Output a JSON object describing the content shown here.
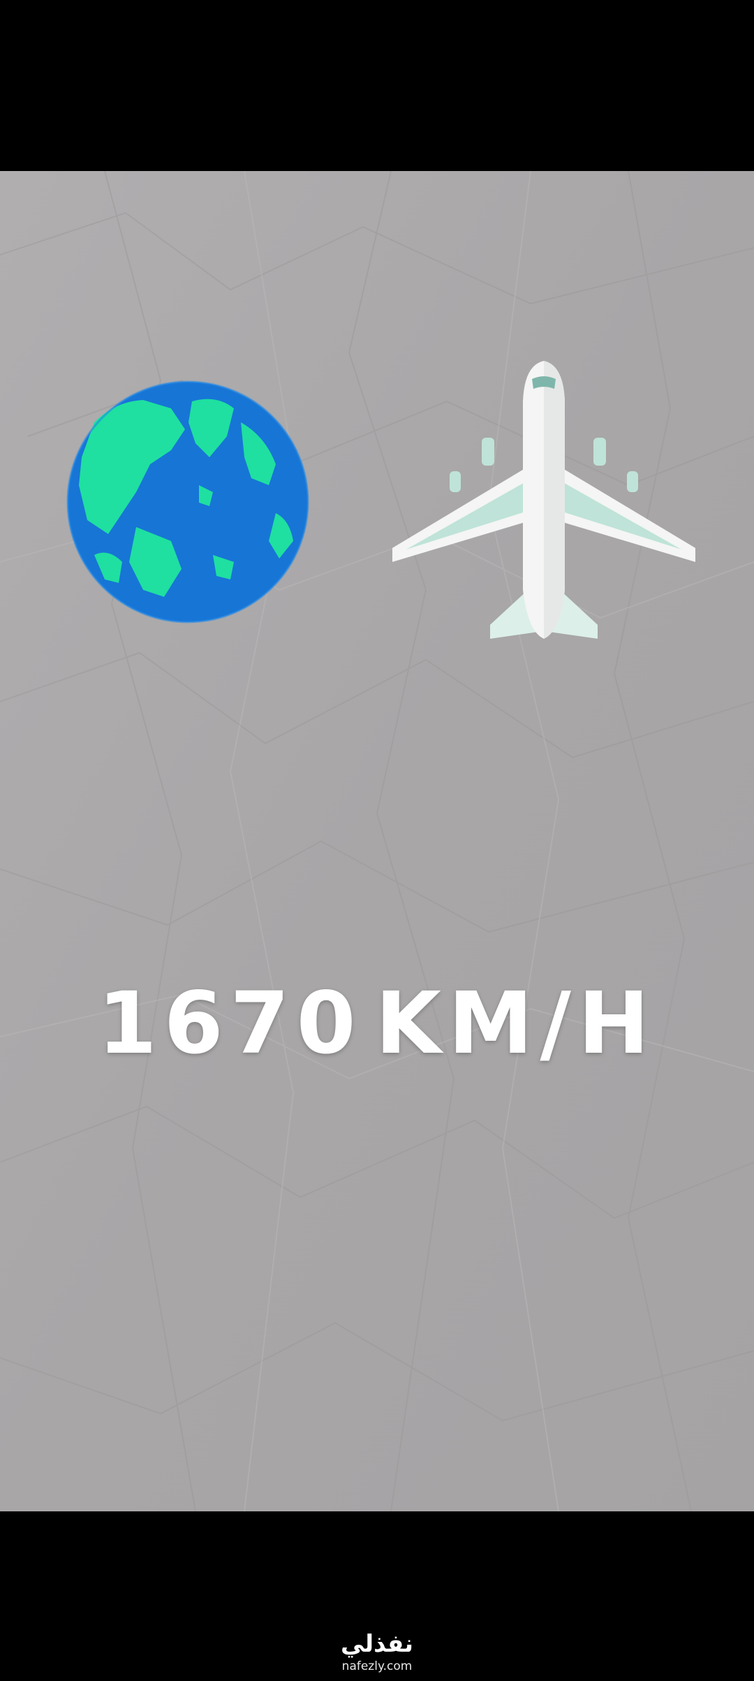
{
  "video": {
    "speed_value": "1670",
    "speed_unit": "KM/H",
    "earth_icon": "earth-globe-icon",
    "plane_icon": "airplane-icon"
  },
  "watermark": {
    "brand_arabic": "نفذلي",
    "url": "nafezly.com"
  },
  "colors": {
    "background_paper": "#a9a7a8",
    "ocean": "#1775d6",
    "land": "#1fe0a0",
    "plane_body": "#f4f5f4",
    "plane_accent": "#bfe3d8",
    "text": "#ffffff",
    "letterbox": "#000000"
  }
}
